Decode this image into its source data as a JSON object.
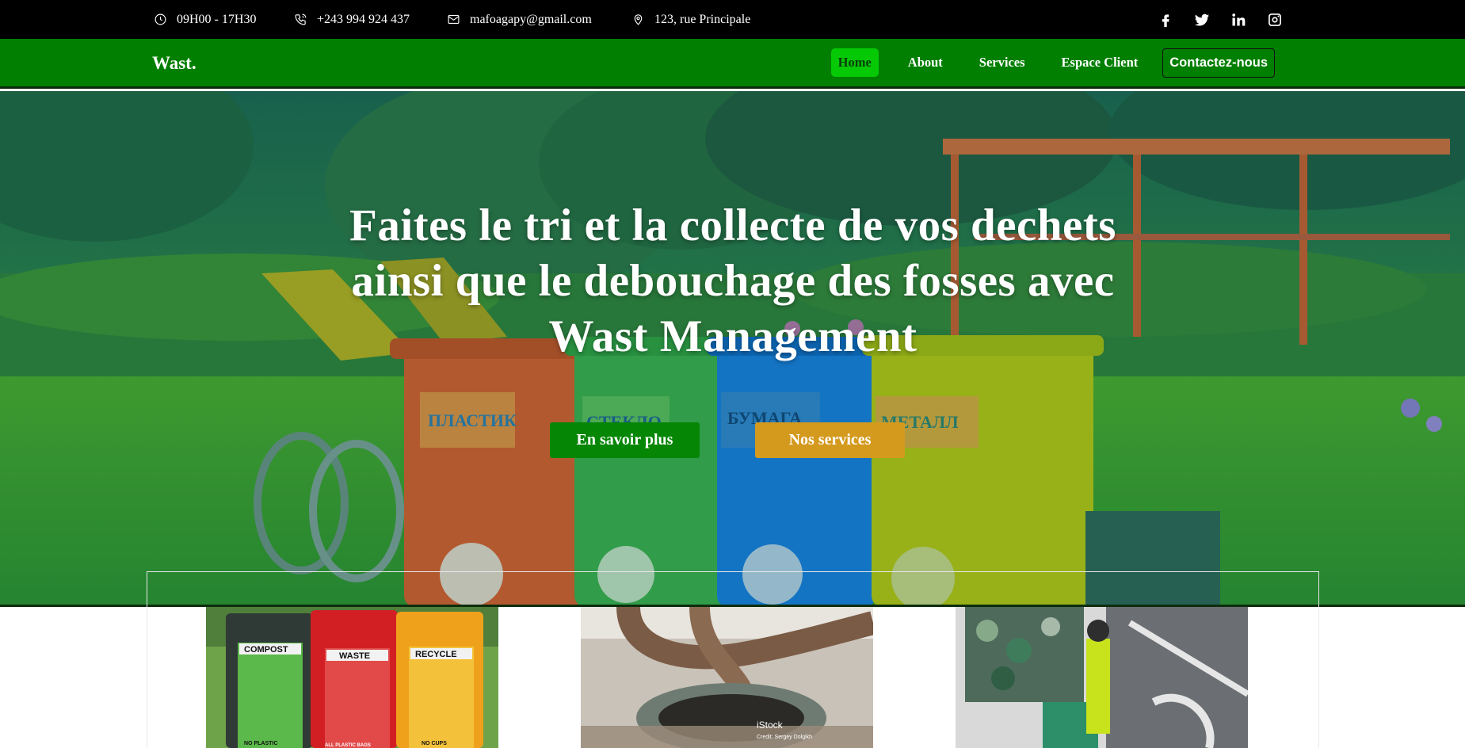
{
  "topbar": {
    "hours": "09H00 - 17H30",
    "phone": "+243 994 924 437",
    "email": "mafoagapy@gmail.com",
    "address": "123, rue Principale",
    "icons": [
      "clock-icon",
      "phone-icon",
      "mail-icon",
      "location-pin-icon"
    ],
    "social": [
      "facebook-icon",
      "twitter-icon",
      "linkedin-icon",
      "instagram-icon"
    ]
  },
  "navbar": {
    "brand": "Wast.",
    "items": [
      {
        "label": "Home",
        "active": true
      },
      {
        "label": "About",
        "active": false
      },
      {
        "label": "Services",
        "active": false
      },
      {
        "label": "Espace Client",
        "active": false
      }
    ],
    "contact_label": "Contactez-nous"
  },
  "hero": {
    "title": "Faites le tri et la collecte de vos dechets ainsi que le debouchage des fosses avec Wast Management",
    "primary_button": "En savoir plus",
    "secondary_button": "Nos services",
    "bin_labels": [
      "ПЛАСТИК",
      "СТЕКЛО",
      "БУМАГА",
      "МЕТАЛЛ"
    ]
  },
  "services": {
    "images": [
      {
        "labels": [
          "COMPOST",
          "WASTE",
          "RECYCLE"
        ],
        "footers": [
          "NO PLASTIC",
          "ALL PLASTIC BAGS",
          "NO CUPS"
        ]
      },
      {
        "watermark": "iStock",
        "credit": "Credit: Sergey Dolgikh"
      },
      {}
    ]
  },
  "colors": {
    "topbar": "#000000",
    "navbar": "#017f01",
    "nav_active": "#06c906",
    "button_green": "#058605",
    "button_gold": "#d49a1e"
  }
}
